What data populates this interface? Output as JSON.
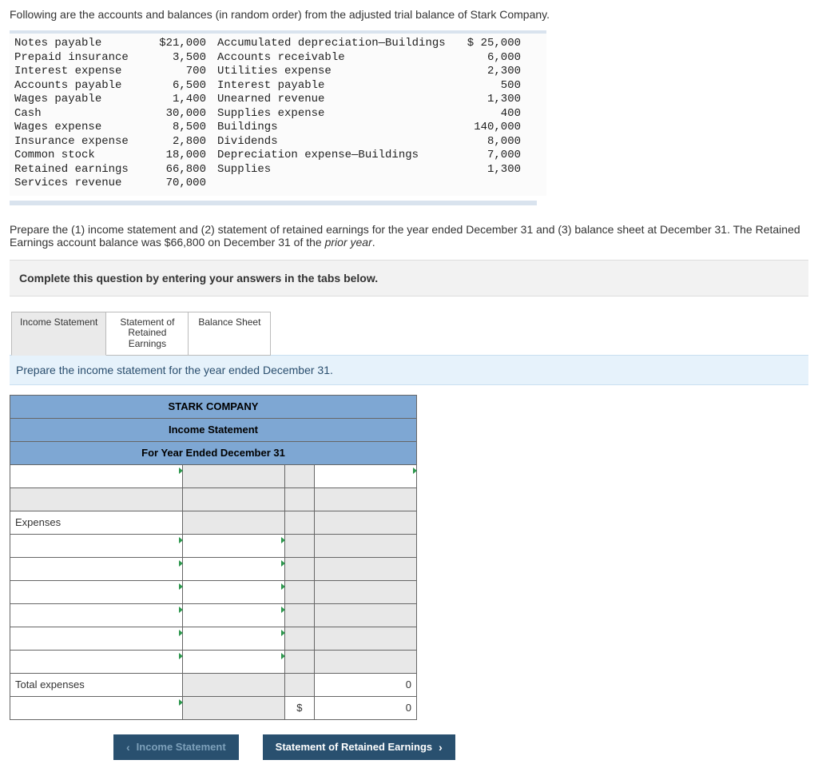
{
  "intro": "Following are the accounts and balances (in random order) from the adjusted trial balance of Stark Company.",
  "trial_balance": {
    "left": [
      {
        "name": "Notes payable",
        "amount": "$21,000"
      },
      {
        "name": "Prepaid insurance",
        "amount": "3,500"
      },
      {
        "name": "Interest expense",
        "amount": "700"
      },
      {
        "name": "Accounts payable",
        "amount": "6,500"
      },
      {
        "name": "Wages payable",
        "amount": "1,400"
      },
      {
        "name": "Cash",
        "amount": "30,000"
      },
      {
        "name": "Wages expense",
        "amount": "8,500"
      },
      {
        "name": "Insurance expense",
        "amount": "2,800"
      },
      {
        "name": "Common stock",
        "amount": "18,000"
      },
      {
        "name": "Retained earnings",
        "amount": "66,800"
      },
      {
        "name": "Services revenue",
        "amount": "70,000"
      }
    ],
    "right": [
      {
        "name": "Accumulated depreciation—Buildings",
        "amount": "$ 25,000"
      },
      {
        "name": "Accounts receivable",
        "amount": "6,000"
      },
      {
        "name": "Utilities expense",
        "amount": "2,300"
      },
      {
        "name": "Interest payable",
        "amount": "500"
      },
      {
        "name": "Unearned revenue",
        "amount": "1,300"
      },
      {
        "name": "Supplies expense",
        "amount": "400"
      },
      {
        "name": "Buildings",
        "amount": "140,000"
      },
      {
        "name": "Dividends",
        "amount": "8,000"
      },
      {
        "name": "Depreciation expense—Buildings",
        "amount": "7,000"
      },
      {
        "name": "Supplies",
        "amount": "1,300"
      }
    ]
  },
  "question_a": "Prepare the (1) income statement and (2) statement of retained earnings for the year ended December 31 and (3) balance sheet at December 31. The Retained Earnings account balance was $66,800 on December 31 of the ",
  "question_b": "prior year",
  "question_c": ".",
  "instruction_box": "Complete this question by entering your answers in the tabs below.",
  "tabs": {
    "t1": "Income Statement",
    "t2a": "Statement of",
    "t2b": "Retained",
    "t2c": "Earnings",
    "t3": "Balance Sheet"
  },
  "tab_instruction": "Prepare the income statement for the year ended December 31.",
  "statement": {
    "h1": "STARK COMPANY",
    "h2": "Income Statement",
    "h3": "For Year Ended December 31",
    "expenses_label": "Expenses",
    "total_expenses_label": "Total expenses",
    "total_expenses_value": "0",
    "dollar": "$",
    "net_value": "0"
  },
  "nav": {
    "prev": "Income Statement",
    "next": "Statement of Retained Earnings"
  }
}
